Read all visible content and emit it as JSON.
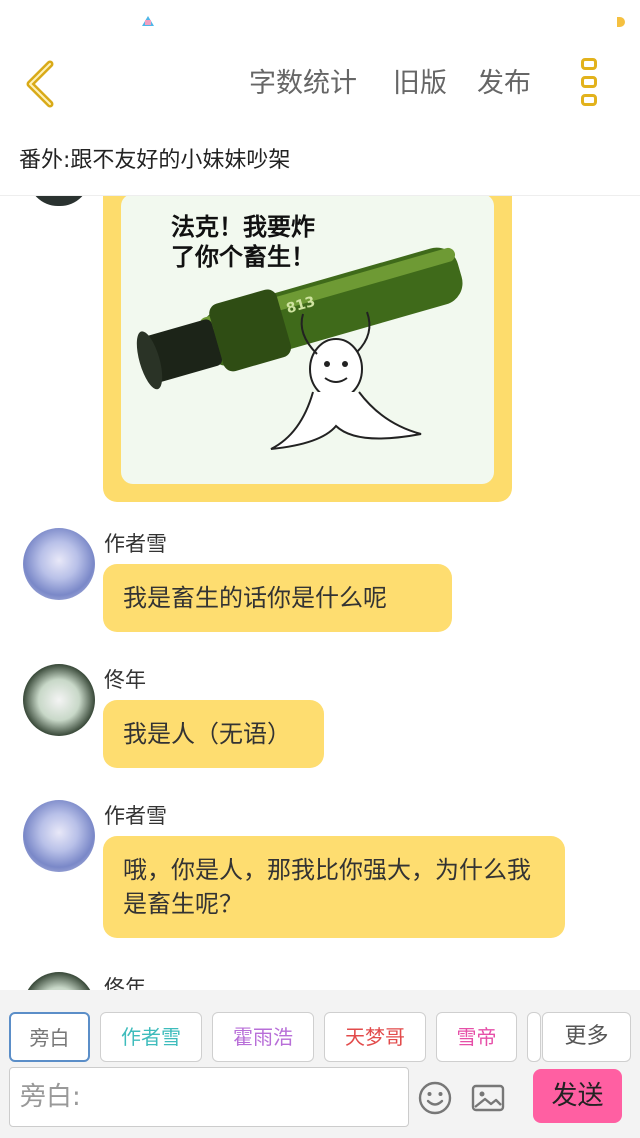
{
  "header": {
    "word_count": "字数统计",
    "old_version": "旧版",
    "publish": "发布"
  },
  "chapter_title": "番外:跟不友好的小妹妹吵架",
  "meme": {
    "caption": "法克！我要炸\n了你个畜生！",
    "launcher_text": "813"
  },
  "messages": [
    {
      "speaker": "作者雪",
      "text": "我是畜生的话你是什么呢"
    },
    {
      "speaker": "佟年",
      "text": "我是人（无语）"
    },
    {
      "speaker": "作者雪",
      "text": "哦，你是人，那我比你强大，为什么我是畜生呢？"
    },
    {
      "speaker": "佟年",
      "text": ""
    }
  ],
  "roles": {
    "narrator": "旁白",
    "xue": "作者雪",
    "huo": "霍雨浩",
    "tianmeng": "天梦哥",
    "xuedi": "雪帝",
    "more": "更多"
  },
  "composer": {
    "placeholder": "旁白:",
    "send": "发送"
  },
  "colors": {
    "bubble": "#fedd70",
    "accent": "#e2b21c",
    "send": "#ff5fa2"
  }
}
